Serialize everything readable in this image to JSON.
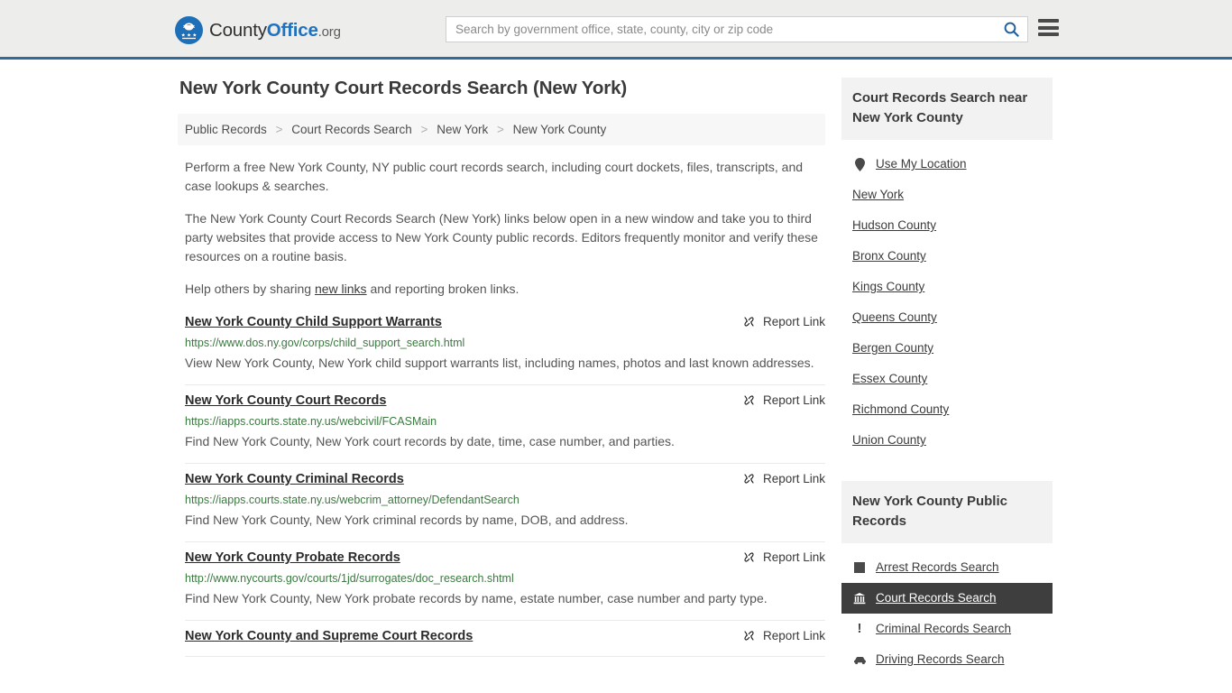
{
  "header": {
    "logo": {
      "part1": "County",
      "part2": "Office",
      "tld": ".org",
      "icon": "eagle-seal-logo"
    },
    "search": {
      "placeholder": "Search by government office, state, county, city or zip code",
      "value": "",
      "button_icon": "search-icon"
    },
    "menu_icon": "hamburger-menu-icon",
    "accent_color": "#34699c",
    "background_color": "#ededec"
  },
  "page": {
    "title": "New York County Court Records Search (New York)"
  },
  "breadcrumb": {
    "separator": ">",
    "items": [
      {
        "label": "Public Records",
        "current": false
      },
      {
        "label": "Court Records Search",
        "current": false
      },
      {
        "label": "New York",
        "current": false
      },
      {
        "label": "New York County",
        "current": true
      }
    ]
  },
  "intro": {
    "p1": "Perform a free New York County, NY public court records search, including court dockets, files, transcripts, and case lookups & searches.",
    "p2": "The New York County Court Records Search (New York) links below open in a new window and take you to third party websites that provide access to New York County public records. Editors frequently monitor and verify these resources on a routine basis.",
    "p3_before": "Help others by sharing ",
    "p3_link": "new links",
    "p3_after": " and reporting broken links."
  },
  "results": {
    "report_label": "Report Link",
    "report_icon": "broken-link-icon",
    "items": [
      {
        "title": "New York County Child Support Warrants",
        "url": "https://www.dos.ny.gov/corps/child_support_search.html",
        "description": "View New York County, New York child support warrants list, including names, photos and last known addresses."
      },
      {
        "title": "New York County Court Records",
        "url": "https://iapps.courts.state.ny.us/webcivil/FCASMain",
        "description": "Find New York County, New York court records by date, time, case number, and parties."
      },
      {
        "title": "New York County Criminal Records",
        "url": "https://iapps.courts.state.ny.us/webcrim_attorney/DefendantSearch",
        "description": "Find New York County, New York criminal records by name, DOB, and address."
      },
      {
        "title": "New York County Probate Records",
        "url": "http://www.nycourts.gov/courts/1jd/surrogates/doc_research.shtml",
        "description": "Find New York County, New York probate records by name, estate number, case number and party type."
      },
      {
        "title": "New York County and Supreme Court Records",
        "url": "",
        "description": ""
      }
    ]
  },
  "sidebar": {
    "nearby": {
      "heading": "Court Records Search near New York County",
      "items": [
        {
          "label": "Use My Location",
          "icon": "map-pin-icon",
          "active": false
        },
        {
          "label": "New York",
          "icon": "",
          "active": false
        },
        {
          "label": "Hudson County",
          "icon": "",
          "active": false
        },
        {
          "label": "Bronx County",
          "icon": "",
          "active": false
        },
        {
          "label": "Kings County",
          "icon": "",
          "active": false
        },
        {
          "label": "Queens County",
          "icon": "",
          "active": false
        },
        {
          "label": "Bergen County",
          "icon": "",
          "active": false
        },
        {
          "label": "Essex County",
          "icon": "",
          "active": false
        },
        {
          "label": "Richmond County",
          "icon": "",
          "active": false
        },
        {
          "label": "Union County",
          "icon": "",
          "active": false
        }
      ]
    },
    "public_records": {
      "heading": "New York County Public Records",
      "items": [
        {
          "label": "Arrest Records Search",
          "icon": "square-icon",
          "active": false
        },
        {
          "label": "Court Records Search",
          "icon": "courthouse-icon",
          "active": true
        },
        {
          "label": "Criminal Records Search",
          "icon": "exclamation-icon",
          "active": false
        },
        {
          "label": "Driving Records Search",
          "icon": "car-icon",
          "active": false
        }
      ]
    }
  }
}
